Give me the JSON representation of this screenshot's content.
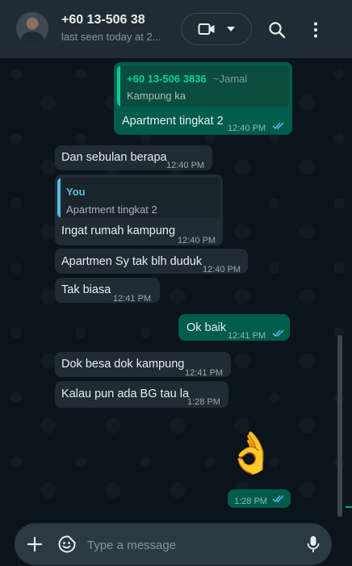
{
  "header": {
    "name": "+60 13-506 38",
    "status": "last seen today at 2..."
  },
  "messages": {
    "m1": {
      "quote_author": "+60 13-506 3836",
      "quote_alias": "~Jamal",
      "quote_text": "Kampung ka",
      "text": "Apartment tingkat 2",
      "time": "12:40 PM"
    },
    "m2": {
      "text": "Dan sebulan berapa",
      "time": "12:40 PM"
    },
    "m3": {
      "quote_author": "You",
      "quote_text": "Apartment tingkat 2",
      "text": "Ingat rumah kampung",
      "time": "12:40 PM"
    },
    "m4": {
      "text": "Apartmen Sy tak blh duduk",
      "time": "12:40 PM"
    },
    "m5": {
      "text": "Tak biasa",
      "time": "12:41 PM"
    },
    "m6": {
      "text": "Ok baik",
      "time": "12:41 PM"
    },
    "m7": {
      "text": "Dok besa dok kampung",
      "time": "12:41 PM"
    },
    "m8": {
      "text": "Kalau pun ada BG tau la",
      "time": "1:28 PM"
    },
    "m9": {
      "emoji": "👌",
      "time": "1:28 PM"
    }
  },
  "composer": {
    "placeholder": "Type a message"
  },
  "colors": {
    "incoming": "#202c33",
    "outgoing": "#005c4b",
    "accent": "#00a884",
    "read_ticks": "#53bdeb"
  },
  "icons": [
    "video-call-icon",
    "chevron-down-icon",
    "search-icon",
    "more-options-icon",
    "plus-icon",
    "sticker-icon",
    "microphone-icon",
    "double-check-icon"
  ]
}
